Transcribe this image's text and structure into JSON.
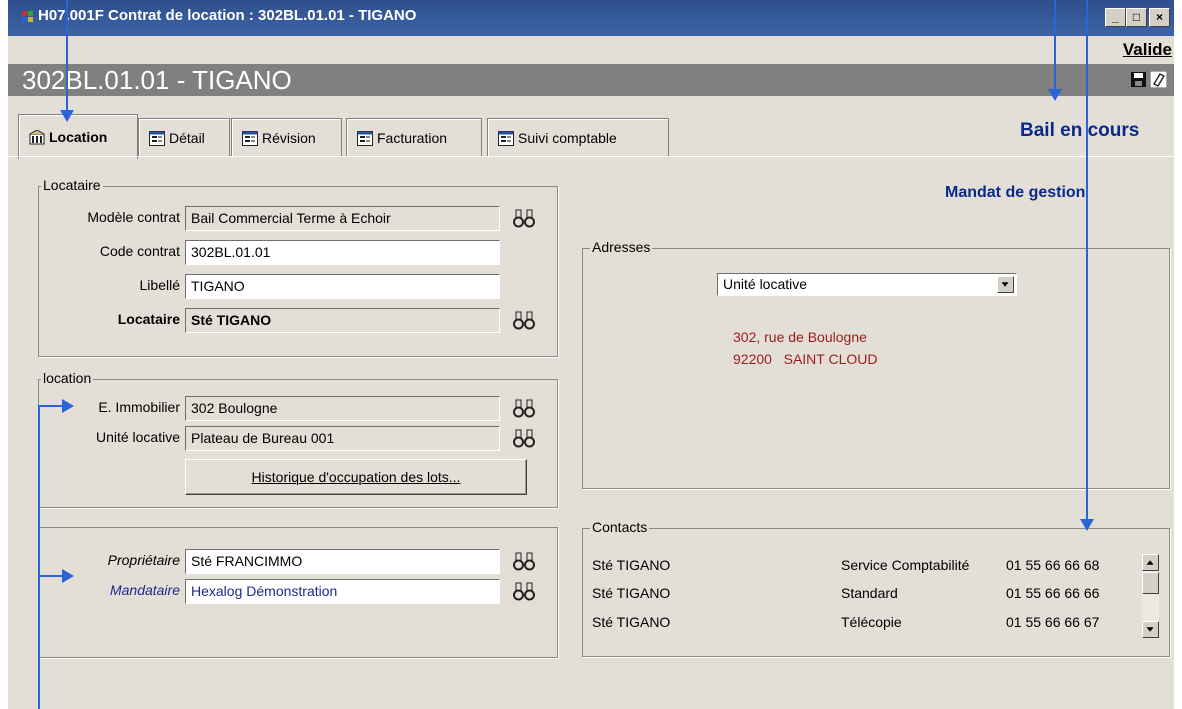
{
  "window": {
    "title": "H07.001F  Contrat de location : 302BL.01.01  - TIGANO",
    "minimize": "_",
    "maximize": "□",
    "close": "×"
  },
  "header": {
    "status_link": "Valide",
    "record_title": "302BL.01.01  -  TIGANO"
  },
  "tabs": [
    {
      "label": "Location",
      "active": true
    },
    {
      "label": "Détail"
    },
    {
      "label": "Révision"
    },
    {
      "label": "Facturation"
    },
    {
      "label": "Suivi comptable"
    }
  ],
  "bail_status": "Bail en cours",
  "mandat": "Mandat de gestion",
  "locataire_group": {
    "title": "Locataire",
    "modele_label": "Modèle contrat",
    "modele_value": "Bail Commercial Terme à Echoir",
    "code_label": "Code contrat",
    "code_value": "302BL.01.01",
    "libelle_label": "Libellé",
    "libelle_value": "TIGANO",
    "locataire_label": "Locataire",
    "locataire_value": "Sté TIGANO"
  },
  "location_group": {
    "title": "location",
    "immeuble_label": "E. Immobilier",
    "immeuble_value": "302 Boulogne",
    "unite_label": "Unité locative",
    "unite_value": "Plateau de Bureau 001",
    "historique_button": "Historique d'occupation des lots..."
  },
  "owner_group": {
    "proprietaire_label": "Propriétaire",
    "proprietaire_value": "Sté FRANCIMMO",
    "mandataire_label": "Mandataire",
    "mandataire_value": "Hexalog Démonstration"
  },
  "adresses_group": {
    "title": "Adresses",
    "select_value": "Unité locative",
    "address_line1": "302, rue de Boulogne",
    "address_line2": "92200   SAINT CLOUD"
  },
  "contacts_group": {
    "title": "Contacts",
    "rows": [
      {
        "name": "Sté TIGANO",
        "type": "Service Comptabilité",
        "phone": "01 55 66 66 68"
      },
      {
        "name": "Sté TIGANO",
        "type": "Standard",
        "phone": "01 55 66 66 66"
      },
      {
        "name": "Sté TIGANO",
        "type": "Télécopie",
        "phone": "01 55 66 66 67"
      }
    ]
  },
  "colors": {
    "title_bar": "#3d64a8",
    "window_bg": "#e3dfd7",
    "band": "#808080",
    "accent_text": "#0a2a8a",
    "address_text": "#9b1c1c",
    "annotation_arrow": "#2b63d8"
  }
}
